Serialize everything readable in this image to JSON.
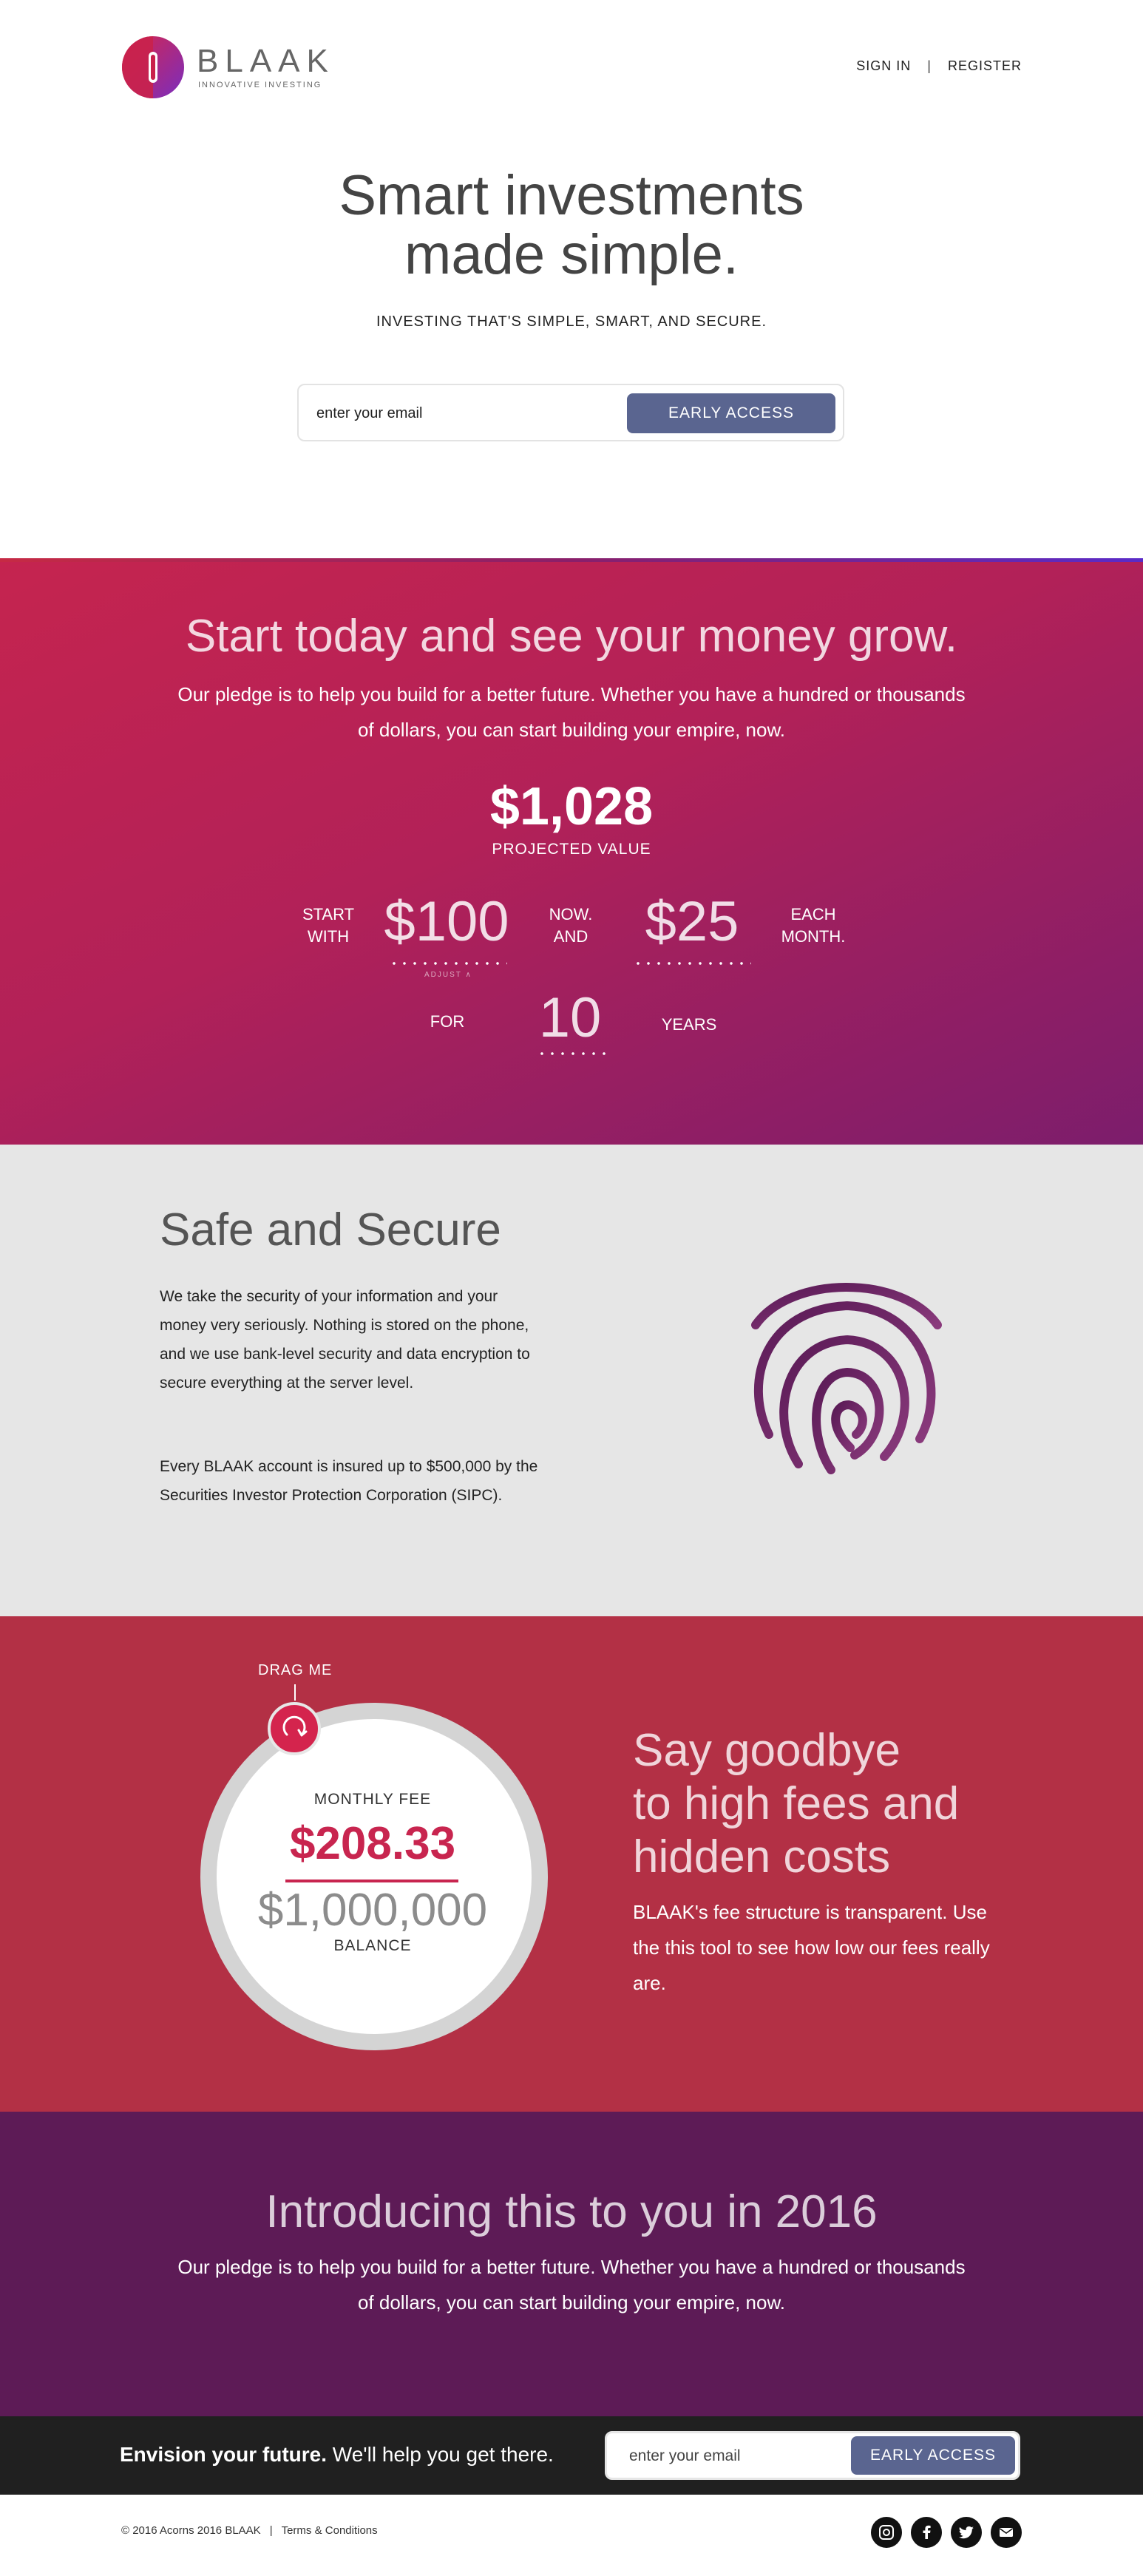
{
  "header": {
    "brand": "BLAAK",
    "tagline": "INNOVATIVE INVESTING",
    "nav": {
      "sign_in": "SIGN IN",
      "separator": "|",
      "register": "REGISTER"
    }
  },
  "hero": {
    "title_line1": "Smart investments",
    "title_line2": "made simple.",
    "subtitle": "INVESTING THAT'S SIMPLE, SMART, AND SECURE.",
    "email_placeholder": "enter your email",
    "button": "EARLY ACCESS"
  },
  "grow": {
    "title": "Start today and see your money grow.",
    "text": "Our pledge is to help you build for a better future. Whether you have a hundred or thousands of dollars, you can start building your empire, now.",
    "projected_value": "$1,028",
    "projected_label": "PROJECTED VALUE",
    "start_with_1": "START",
    "start_with_2": "WITH",
    "start_amount": "$100",
    "adjust_hint": "ADJUST ∧",
    "now_and_1": "NOW.",
    "now_and_2": "AND",
    "monthly_amount": "$25",
    "each_month_1": "EACH",
    "each_month_2": "MONTH.",
    "for_label": "FOR",
    "years_value": "10",
    "years_label": "YEARS"
  },
  "safe": {
    "title": "Safe and Secure",
    "p1": "We take the security of your information and your money very seriously. Nothing is stored on the phone, and we use bank-level security and data encryption to secure everything at the server level.",
    "p2": "Every BLAAK account is insured up to $500,000 by the Securities Investor Protection Corporation (SIPC).",
    "icon": "fingerprint-icon"
  },
  "fees": {
    "drag_label": "DRAG ME",
    "monthly_fee_label": "MONTHLY FEE",
    "monthly_fee": "$208.33",
    "balance": "$1,000,000",
    "balance_label": "BALANCE",
    "title_line1": "Say goodbye",
    "title_line2": "to high fees and",
    "title_line3": "hidden costs",
    "text": "BLAAK's fee structure is transparent. Use the this tool to see how low our fees really are."
  },
  "intro": {
    "title": "Introducing this to you in 2016",
    "text": "Our pledge is to help you build for a better future. Whether you have a hundred or thousands of dollars, you can start building your empire, now."
  },
  "cta": {
    "bold": "Envision your future.",
    "rest": " We'll help you get there.",
    "email_placeholder": "enter your email",
    "button": "EARLY ACCESS"
  },
  "footer": {
    "copyright": "© 2016 Acorns 2016 BLAAK",
    "separator": "|",
    "terms": "Terms & Conditions",
    "socials": [
      "instagram-icon",
      "facebook-icon",
      "twitter-icon",
      "mail-icon"
    ]
  },
  "colors": {
    "accent_button": "#5a6590",
    "grow_start": "#c5244f",
    "grow_end": "#7c1d6c",
    "safe_bg": "#e6e6e6",
    "fees_bg": "#b33045",
    "fee_red": "#c8254f",
    "intro_bg": "#5d1b56",
    "cta_bar_bg": "#202020"
  }
}
